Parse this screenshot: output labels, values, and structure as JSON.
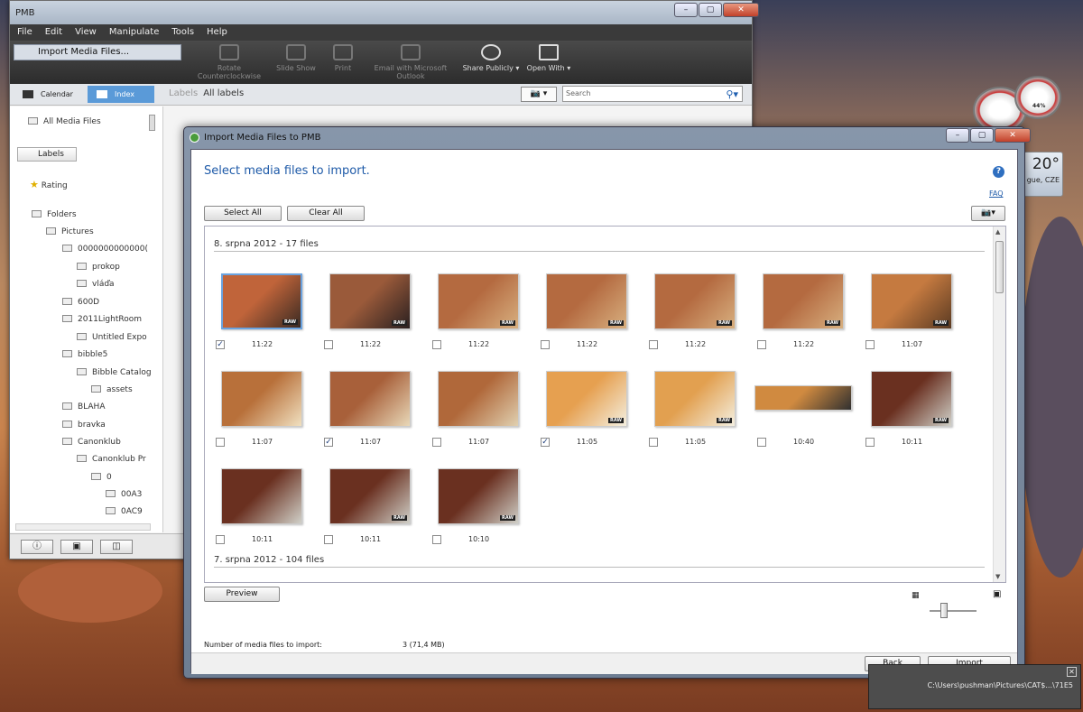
{
  "pmb": {
    "title": "PMB",
    "menu": [
      "File",
      "Edit",
      "View",
      "Manipulate",
      "Tools",
      "Help"
    ],
    "dropdown_item": "Import Media Files...",
    "toolbar": [
      "Rotate Counterclockwise",
      "Slide Show",
      "Print",
      "Email with Microsoft Outlook",
      "Share Publicly ▾",
      "Open With ▾"
    ],
    "nav": {
      "calendar": "Calendar",
      "index": "Index",
      "labels_crumb": "Labels",
      "all_labels": "All labels",
      "search_placeholder": "Search"
    },
    "sidebar": {
      "all_media": "All Media Files",
      "labels": "Labels",
      "rating": "Rating",
      "folders": "Folders",
      "tree": [
        "Pictures",
        "0000000000000(",
        "prokop",
        "vláďa",
        "600D",
        "2011LightRoom",
        "Untitled Expo",
        "bibble5",
        "Bibble Catalog",
        "assets",
        "BLAHA",
        "bravka",
        "Canonklub",
        "Canonklub Pr",
        "0",
        "00A3",
        "0AC9"
      ]
    }
  },
  "gadgets": {
    "gauge_pct": "44%",
    "temp": "20°",
    "city": "gue, CZE"
  },
  "dialog": {
    "title": "Import Media Files to PMB",
    "heading": "Select media files to import.",
    "faq": "FAQ",
    "select_all": "Select All",
    "clear_all": "Clear All",
    "groups": [
      {
        "header": "8. srpna 2012 - 17 files"
      },
      {
        "header": "7. srpna 2012 - 104 files"
      }
    ],
    "times": [
      "11:22",
      "11:22",
      "11:22",
      "11:22",
      "11:22",
      "11:22",
      "11:07",
      "11:07",
      "11:07",
      "11:07",
      "11:05",
      "11:05",
      "10:40",
      "10:11",
      "10:11",
      "10:11",
      "10:10"
    ],
    "checked": [
      true,
      false,
      false,
      false,
      false,
      false,
      false,
      false,
      true,
      false,
      true,
      false,
      false,
      false,
      false,
      false,
      false
    ],
    "preview": "Preview",
    "count_label": "Number of media files to import:",
    "count_value": "3 (71,4 MB)",
    "back": "Back",
    "import": "Import"
  },
  "status": {
    "path": "C:\\Users\\pushman\\Pictures\\CAT$...\\71E5"
  }
}
